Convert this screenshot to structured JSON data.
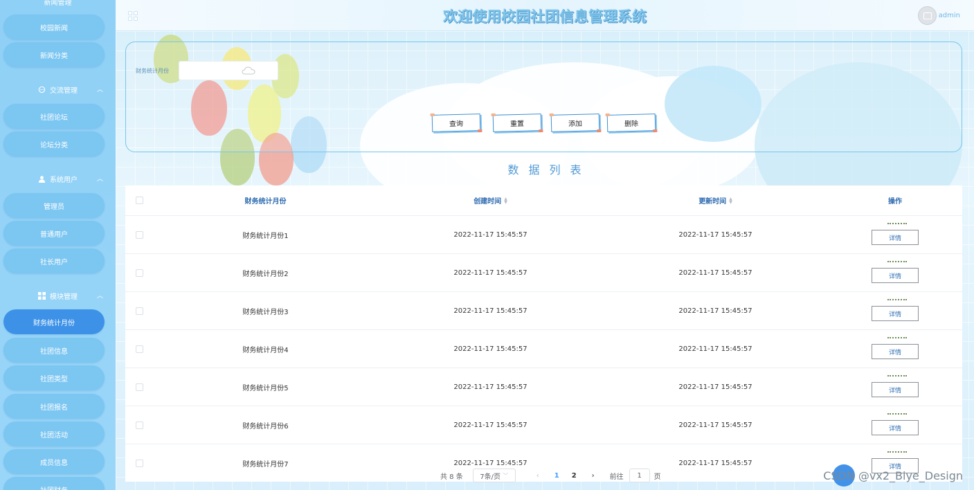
{
  "header": {
    "title": "欢迎使用校园社团信息管理系统",
    "username": "admin"
  },
  "sidebar": {
    "top_partial": "新闻管理",
    "items_a": [
      "校园新闻",
      "新闻分类"
    ],
    "group_exchange": "交流管理",
    "items_b": [
      "社团论坛",
      "论坛分类"
    ],
    "group_users": "系统用户",
    "items_c": [
      "管理员",
      "普通用户",
      "社长用户"
    ],
    "group_modules": "模块管理",
    "active_item": "财务统计月份",
    "items_d": [
      "社团信息",
      "社团类型",
      "社团报名",
      "社团活动",
      "成员信息",
      "社团财务"
    ]
  },
  "search": {
    "label": "财务统计月份",
    "placeholder": "",
    "buttons": {
      "query": "查询",
      "reset": "重置",
      "add": "添加",
      "delete": "删除"
    }
  },
  "list_title": "数据列表",
  "table": {
    "columns": [
      "财务统计月份",
      "创建时间",
      "更新时间",
      "操作"
    ],
    "rows": [
      {
        "name": "财务统计月份1",
        "created": "2022-11-17 15:45:57",
        "updated": "2022-11-17 15:45:57",
        "action": "详情"
      },
      {
        "name": "财务统计月份2",
        "created": "2022-11-17 15:45:57",
        "updated": "2022-11-17 15:45:57",
        "action": "详情"
      },
      {
        "name": "财务统计月份3",
        "created": "2022-11-17 15:45:57",
        "updated": "2022-11-17 15:45:57",
        "action": "详情"
      },
      {
        "name": "财务统计月份4",
        "created": "2022-11-17 15:45:57",
        "updated": "2022-11-17 15:45:57",
        "action": "详情"
      },
      {
        "name": "财务统计月份5",
        "created": "2022-11-17 15:45:57",
        "updated": "2022-11-17 15:45:57",
        "action": "详情"
      },
      {
        "name": "财务统计月份6",
        "created": "2022-11-17 15:45:57",
        "updated": "2022-11-17 15:45:57",
        "action": "详情"
      },
      {
        "name": "财务统计月份7",
        "created": "2022-11-17 15:45:57",
        "updated": "2022-11-17 15:45:57",
        "action": "详情"
      }
    ]
  },
  "pagination": {
    "total": "共 8 条",
    "page_size": "7条/页",
    "pages": [
      "1",
      "2"
    ],
    "current": "1",
    "jump_prefix": "前往",
    "jump_value": "1",
    "jump_suffix": "页"
  },
  "watermark": "CSDN @vx2_Biye_Design",
  "colors": {
    "sidebar_bg": "#8fd0f6",
    "active": "#3d92e8",
    "accent": "#409eff",
    "title": "#7fc4ea"
  }
}
